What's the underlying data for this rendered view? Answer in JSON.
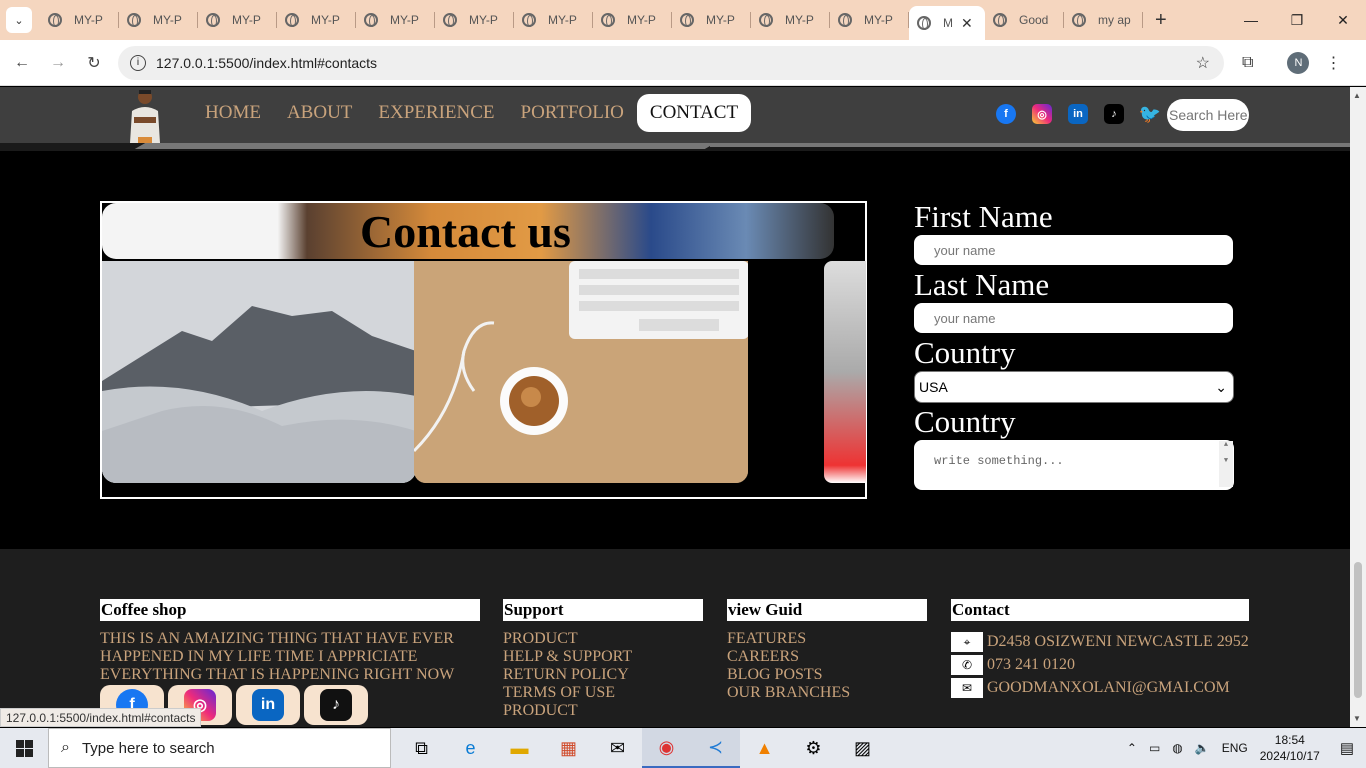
{
  "browser": {
    "tabs": [
      {
        "label": "MY-P"
      },
      {
        "label": "MY-P"
      },
      {
        "label": "MY-P"
      },
      {
        "label": "MY-P"
      },
      {
        "label": "MY-P"
      },
      {
        "label": "MY-P"
      },
      {
        "label": "MY-P"
      },
      {
        "label": "MY-P"
      },
      {
        "label": "MY-P"
      },
      {
        "label": "MY-P"
      },
      {
        "label": "MY-P"
      },
      {
        "label": "M"
      },
      {
        "label": "Good"
      },
      {
        "label": "my ap"
      }
    ],
    "url": "127.0.0.1:5500/index.html#contacts",
    "profile_initial": "N",
    "status_url": "127.0.0.1:5500/index.html#contacts"
  },
  "site": {
    "nav": [
      "HOME",
      "ABOUT",
      "EXPERIENCE",
      "PORTFOLIO",
      "CONTACT"
    ],
    "active_nav": "CONTACT",
    "search_placeholder": "Search Here",
    "socials": [
      "facebook-icon",
      "instagram-icon",
      "linkedin-icon",
      "tiktok-icon",
      "twitter-icon"
    ]
  },
  "contact": {
    "banner_title": "Contact us",
    "form": {
      "first_name_label": "First Name",
      "first_name_placeholder": "your name",
      "last_name_label": "Last Name",
      "last_name_placeholder": "your name",
      "country_label": "Country",
      "country_value": "USA",
      "message_label": "Country",
      "message_placeholder": "write something..."
    }
  },
  "footer": {
    "coffee": {
      "heading": "Coffee shop",
      "text": "THIS IS AN AMAIZING THING THAT HAVE EVER HAPPENED IN MY LIFE TIME I APPRICIATE EVERYTHING THAT IS HAPPENING RIGHT NOW"
    },
    "support": {
      "heading": "Support",
      "links": [
        "PRODUCT",
        "HELP & SUPPORT",
        "RETURN POLICY",
        "TERMS OF USE",
        "PRODUCT"
      ]
    },
    "guide": {
      "heading": "view Guid",
      "links": [
        "FEATURES",
        "CAREERS",
        "BLOG POSTS",
        "OUR BRANCHES"
      ]
    },
    "contact": {
      "heading": "Contact",
      "address": "D2458 OSIZWENI NEWCASTLE 2952",
      "phone": "073 241 0120",
      "email": "GOODMANXOLANI@GMAI.COM"
    }
  },
  "taskbar": {
    "search_placeholder": "Type here to search",
    "language": "ENG",
    "time": "18:54",
    "date": "2024/10/17"
  }
}
